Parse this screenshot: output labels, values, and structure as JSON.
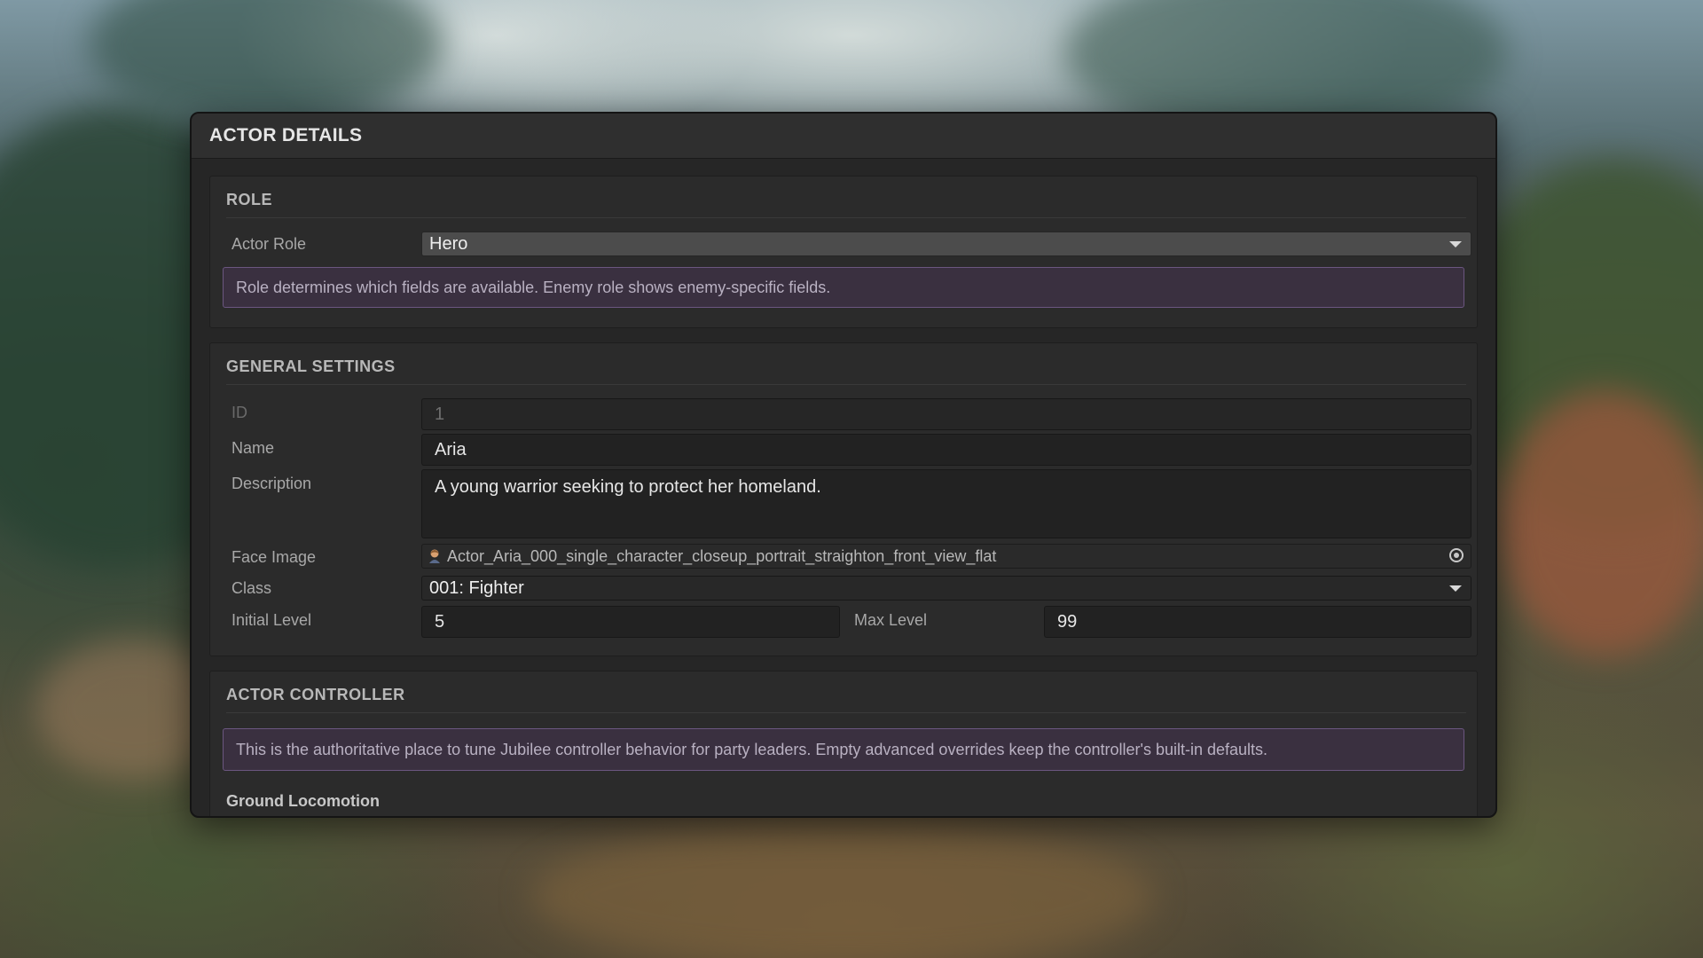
{
  "panel": {
    "title": "ACTOR DETAILS"
  },
  "role": {
    "title": "ROLE",
    "actor_role_label": "Actor Role",
    "actor_role_value": "Hero",
    "info": "Role determines which fields are available. Enemy role shows enemy-specific fields."
  },
  "general": {
    "title": "GENERAL SETTINGS",
    "id_label": "ID",
    "id_value": "1",
    "name_label": "Name",
    "name_value": "Aria",
    "description_label": "Description",
    "description_value": "A young warrior seeking to protect her homeland.",
    "face_label": "Face Image",
    "face_value": "Actor_Aria_000_single_character_closeup_portrait_straighton_front_view_flat",
    "class_label": "Class",
    "class_value": "001: Fighter",
    "initial_level_label": "Initial Level",
    "initial_level_value": "5",
    "max_level_label": "Max Level",
    "max_level_value": "99"
  },
  "controller": {
    "title": "ACTOR CONTROLLER",
    "info": "This is the authoritative place to tune Jubilee controller behavior for party leaders. Empty advanced overrides keep the controller's built-in defaults.",
    "subheading": "Ground Locomotion"
  },
  "icons": {
    "face": "portrait-icon",
    "target": "object-picker-icon",
    "caret": "chevron-down-icon"
  },
  "colors": {
    "panel_bg": "#262626",
    "info_bg": "#3a3040",
    "info_border": "#6b5680",
    "dropdown_bg": "#4c4c4c"
  }
}
